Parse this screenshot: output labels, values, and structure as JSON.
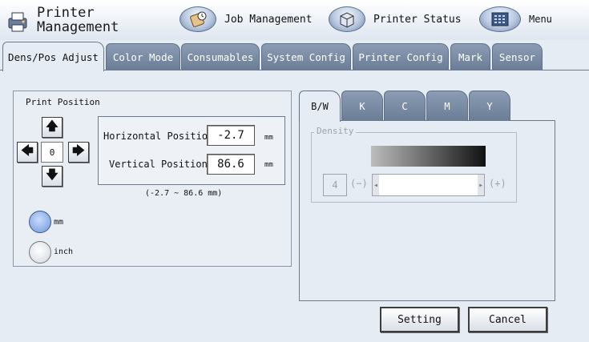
{
  "header": {
    "title_line1": "Printer",
    "title_line2": "Management",
    "buttons": [
      {
        "label": "Job Management",
        "icon": "job-management-icon"
      },
      {
        "label": "Printer Status",
        "icon": "printer-status-icon"
      },
      {
        "label": "Menu",
        "icon": "menu-grid-icon"
      }
    ]
  },
  "tabs": [
    "Dens/Pos Adjust",
    "Color Mode",
    "Consumables",
    "System Config",
    "Printer Config",
    "Mark",
    "Sensor"
  ],
  "active_tab": "Dens/Pos Adjust",
  "print_position": {
    "title": "Print Position",
    "center_value": "0",
    "horizontal_label": "Horizontal Position",
    "horizontal_value": "-2.7",
    "vertical_label": "Vertical Position",
    "vertical_value": "86.6",
    "unit": "mm",
    "range_text": "(-2.7 ~ 86.6 mm)",
    "unit_options": [
      {
        "label": "mm",
        "selected": true
      },
      {
        "label": "inch",
        "selected": false
      }
    ]
  },
  "color_tabs": [
    "B/W",
    "K",
    "C",
    "M",
    "Y"
  ],
  "active_color_tab": "B/W",
  "density": {
    "legend": "Density",
    "value": "4",
    "minus_label": "(−)",
    "plus_label": "(+)"
  },
  "actions": {
    "setting_label": "Setting",
    "cancel_label": "Cancel"
  },
  "colors": {
    "background": "#e6ecf4",
    "inactive_tab": "#7b8ca6",
    "radio_selected": "#6f96d8"
  }
}
